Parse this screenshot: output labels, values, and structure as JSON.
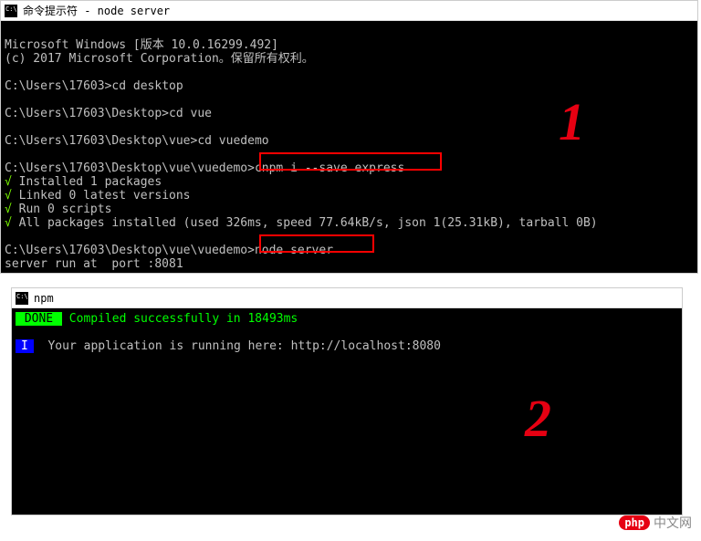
{
  "window1": {
    "title": "命令提示符 - node  server",
    "lines": {
      "l1": "Microsoft Windows [版本 10.0.16299.492]",
      "l2": "(c) 2017 Microsoft Corporation。保留所有权利。",
      "l3": "",
      "l4_prompt": "C:\\Users\\17603>",
      "l4_cmd": "cd desktop",
      "l5": "",
      "l6_prompt": "C:\\Users\\17603\\Desktop>",
      "l6_cmd": "cd vue",
      "l7": "",
      "l8_prompt": "C:\\Users\\17603\\Desktop\\vue>",
      "l8_cmd": "cd vuedemo",
      "l9": "",
      "l10_prompt": "C:\\Users\\17603\\Desktop\\vue\\vuedemo>",
      "l10_cmd": "cnpm i --save express",
      "l11_check": "√",
      "l11_text": " Installed 1 packages",
      "l12_check": "√",
      "l12_text": " Linked 0 latest versions",
      "l13_check": "√",
      "l13_text": " Run 0 scripts",
      "l14_check": "√",
      "l14_text": " All packages installed (used 326ms, speed 77.64kB/s, json 1(25.31kB), tarball 0B)",
      "l15": "",
      "l16_prompt": "C:\\Users\\17603\\Desktop\\vue\\vuedemo>",
      "l16_cmd": "node server",
      "l17": "server run at  port :8081"
    }
  },
  "window2": {
    "title": "npm",
    "done_badge": " DONE ",
    "done_text": " Compiled successfully in 18493ms",
    "info_badge": "I",
    "info_text": "  Your application is running here: http://localhost:8080"
  },
  "annotations": {
    "one": "1",
    "two": "2"
  },
  "watermark": {
    "php": "php",
    "site": "中文网"
  }
}
